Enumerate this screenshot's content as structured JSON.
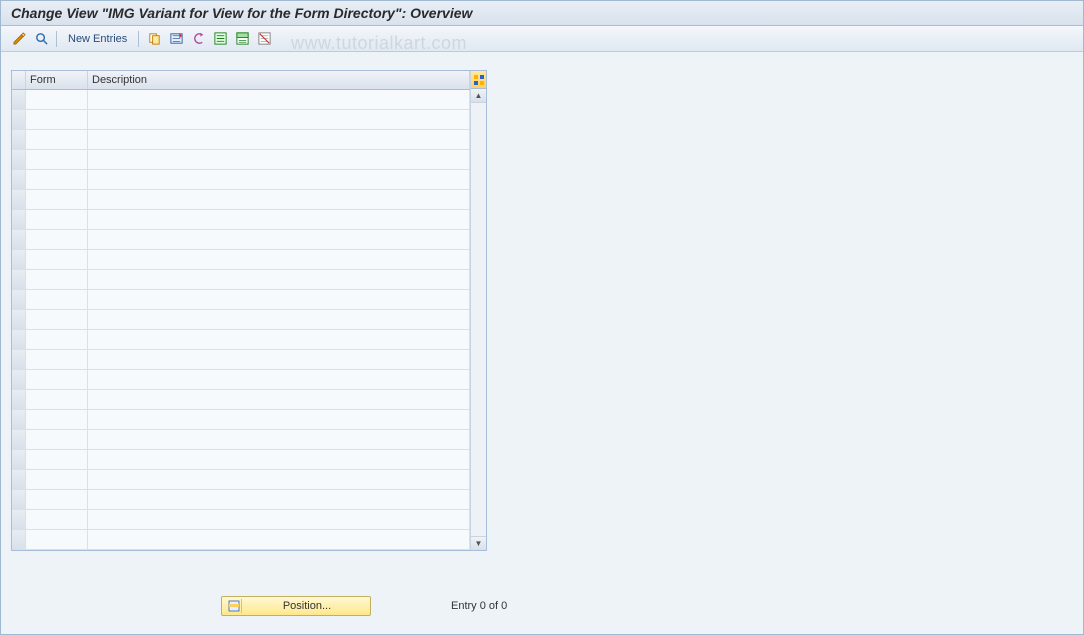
{
  "title": "Change View \"IMG Variant for View for the Form Directory\": Overview",
  "watermark": "www.tutorialkart.com",
  "toolbar": {
    "toggle_label": "",
    "find_label": "",
    "new_entries_label": "New Entries"
  },
  "table": {
    "columns": {
      "sel": "",
      "form": "Form",
      "desc": "Description"
    },
    "rows_count": 23
  },
  "footer": {
    "position_label": "Position...",
    "entry_text": "Entry 0 of 0"
  }
}
